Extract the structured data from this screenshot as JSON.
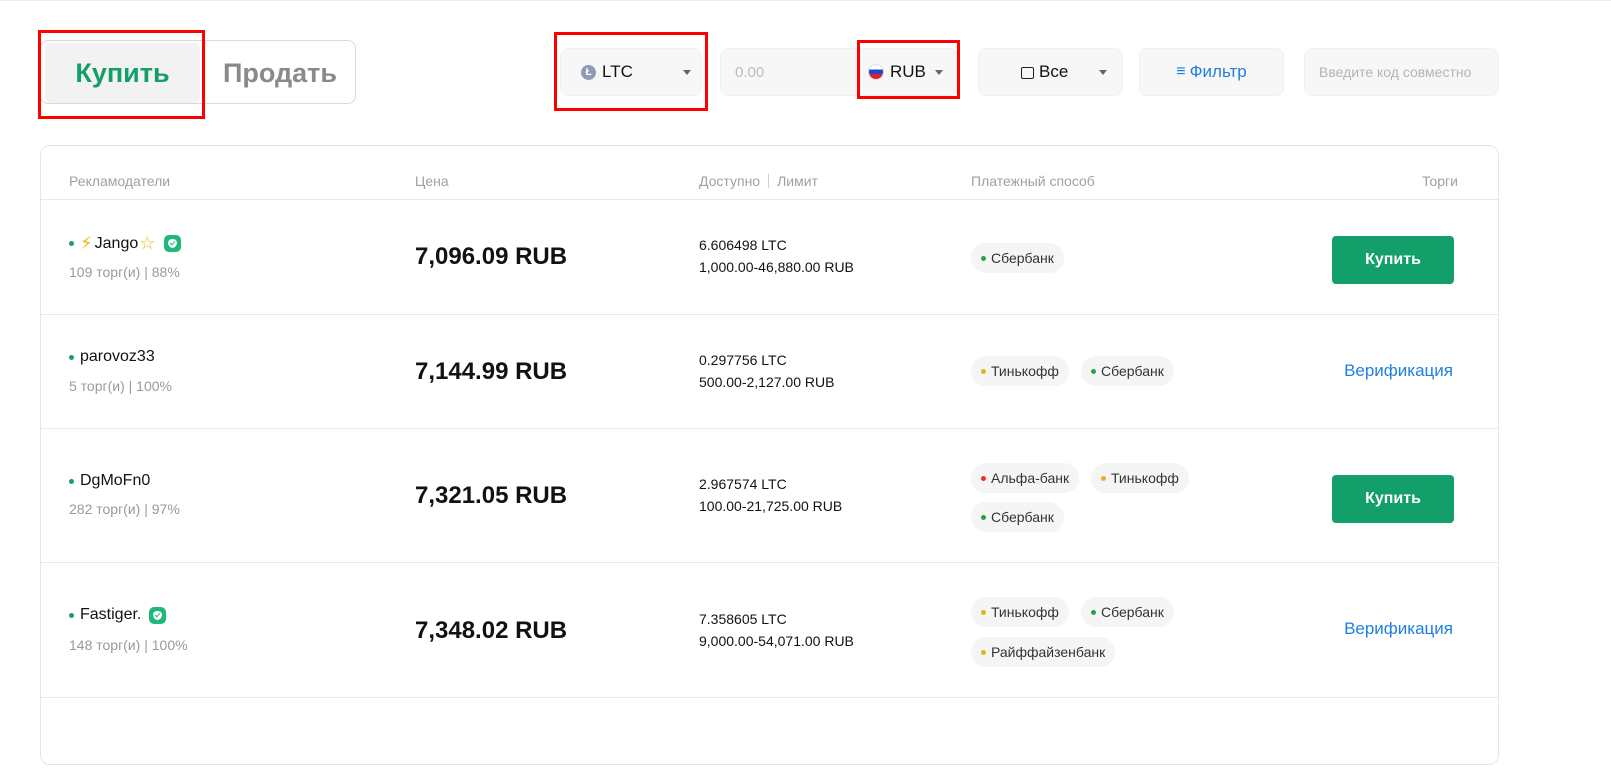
{
  "tabs": {
    "buy": "Купить",
    "sell": "Продать"
  },
  "filters": {
    "coin": "LTC",
    "coin_icon": "ltc-coin-icon",
    "amount_placeholder": "0.00",
    "currency": "RUB",
    "currency_icon": "russia-flag-icon",
    "payment": "Все",
    "filter_label": "Фильтр",
    "code_placeholder": "Введите код совместно"
  },
  "headers": {
    "advertisers": "Рекламодатели",
    "price": "Цена",
    "available": "Доступно",
    "limit": "Лимит",
    "payment": "Платежный способ",
    "trades": "Торги"
  },
  "rows": [
    {
      "name": "Jango",
      "stats": "109 торг(и) | 88%",
      "price": "7,096.09 RUB",
      "available": "6.606498 LTC",
      "limit": "1,000.00-46,880.00 RUB",
      "payments": [
        "Сбербанк"
      ],
      "action": "Купить"
    },
    {
      "name": "parovoz33",
      "stats": "5 торг(и) | 100%",
      "price": "7,144.99 RUB",
      "available": "0.297756 LTC",
      "limit": "500.00-2,127.00 RUB",
      "payments": [
        "Тинькофф",
        "Сбербанк"
      ],
      "action": "Верификация"
    },
    {
      "name": "DgMoFn0",
      "stats": "282 торг(и) | 97%",
      "price": "7,321.05 RUB",
      "available": "2.967574 LTC",
      "limit": "100.00-21,725.00 RUB",
      "payments": [
        "Альфа-банк",
        "Тинькофф",
        "Сбербанк"
      ],
      "action": "Купить"
    },
    {
      "name": "Fastiger.",
      "stats": "148 торг(и) | 100%",
      "price": "7,348.02 RUB",
      "available": "7.358605 LTC",
      "limit": "9,000.00-54,071.00 RUB",
      "payments": [
        "Тинькофф",
        "Сбербанк",
        "Райффайзенбанк"
      ],
      "action": "Верификация"
    }
  ],
  "colors": {
    "accent": "#139f6a",
    "link": "#1e7fe3",
    "highlight": "#ff0000",
    "dot_sber": "#2ea043",
    "dot_tinkoff": "#e3b21c",
    "dot_alfa": "#ef3124"
  }
}
